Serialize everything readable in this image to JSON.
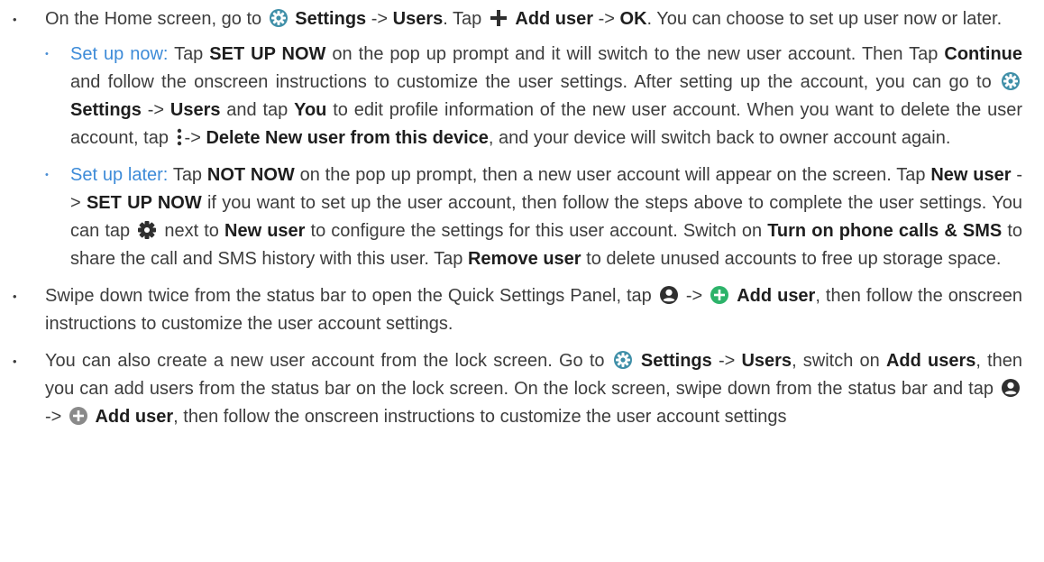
{
  "colors": {
    "text": "#3d3d3d",
    "bold_text": "#1e1e1e",
    "sub_heading": "#3d8bd8",
    "settings_icon": "#3f8fa8",
    "plus_icon_bg": "#2db36a"
  },
  "icons": {
    "settings": "settings-gear-icon",
    "plus": "plus-icon",
    "more": "more-vertical-icon",
    "gear": "gear-icon",
    "account": "account-circle-icon",
    "add_circle": "add-circle-icon"
  },
  "b1": {
    "t1": "On the Home screen, go to",
    "settings": "Settings",
    "arrow": "->",
    "users": "Users",
    "t2": ". Tap",
    "add_user": "Add user",
    "arrow2": "->",
    "ok": "OK",
    "t3": ". You can choose to set up user now or later."
  },
  "s1": {
    "lead": "Set up now:",
    "t1": "Tap",
    "set_up_now": "SET UP NOW",
    "t2": "on the pop up prompt and it will switch to the new user account. Then Tap",
    "continue": "Continue",
    "t3": "and follow the onscreen instructions to customize the user settings. After setting up the account, you can go to",
    "settings": "Settings",
    "arrow": "->",
    "users": "Users",
    "t4": "and tap",
    "you": "You",
    "t5": "to edit profile information of the new user account. When you want to delete the user account, tap",
    "arrow2": "->",
    "delete": "Delete New user from this device",
    "t6": ", and your device will switch back to owner account again."
  },
  "s2": {
    "lead": "Set up later:",
    "t1": "Tap",
    "not_now": "NOT NOW",
    "t2": "on the pop up prompt, then a new user account will appear on the screen. Tap",
    "new_user": "New user",
    "arrow": "->",
    "set_up_now": "SET UP NOW",
    "t3": "if you want to set up the user account, then follow the steps above to complete the user settings. You can tap",
    "t4": "next to",
    "new_user2": "New user",
    "t5": "to configure the settings for this user account. Switch on",
    "phone_calls": "Turn on phone calls & SMS",
    "t6": "to share the call and SMS history with this user. Tap",
    "remove_user": "Remove user",
    "t7": "to delete unused accounts to free up storage space."
  },
  "b2": {
    "t1": "Swipe down twice from the status bar to open the Quick Settings Panel, tap",
    "arrow": "->",
    "add_user": "Add user",
    "t2": ", then follow the  onscreen instructions to customize the user account settings."
  },
  "b3": {
    "t1": "You can also create a new user account from the lock screen. Go to",
    "settings": "Settings",
    "arrow": "->",
    "users": "Users",
    "t2": ", switch on",
    "add_users": "Add users",
    "t3": ", then you can add users from the status bar on the lock screen. On the lock screen, swipe down from the status bar and tap",
    "arrow2": "->",
    "add_user": "Add user",
    "t4": ", then follow the  onscreen instructions to customize the user account settings"
  }
}
